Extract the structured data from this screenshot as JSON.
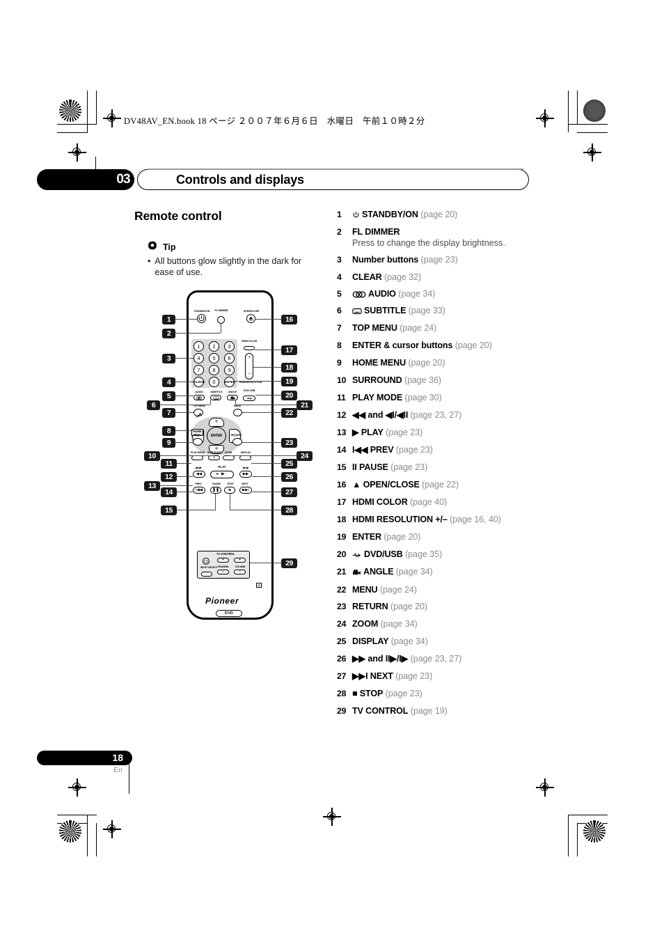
{
  "book_header": "DV48AV_EN.book  18 ページ  ２００７年６月６日　水曜日　午前１０時２分",
  "chapter": {
    "number": "03",
    "title": "Controls and displays"
  },
  "section": {
    "title": "Remote control"
  },
  "tip": {
    "icon": "gear-icon",
    "label": "Tip",
    "bullet": "•",
    "text": "All buttons glow slightly in the dark for ease of use."
  },
  "footer": {
    "page": "18",
    "language": "En"
  },
  "remote": {
    "brand": "Pioneer",
    "mode_badge": "DVD",
    "labels": {
      "standby": "STANDBY/ON",
      "fl_dimmer": "FL DIMMER",
      "open_close": "OPEN/CLOSE",
      "hdmi_color": "HDMI COLOR",
      "hdmi_resolution": "HDMI RESOLUTION",
      "dvd_usb": "DVD/ USB",
      "audio": "AUDIO",
      "subtitle": "SUBTITLE",
      "angle": "ANGLE",
      "clear": "CLEAR",
      "enter": "ENTER",
      "top_menu": "TOP MENU",
      "menu": "MENU",
      "home_menu": "HOME MENU",
      "return": "RETURN",
      "play_mode": "PLAY MODE",
      "surround": "SURROUND",
      "zoom": "ZOOM",
      "display": "DISPLAY",
      "play": "PLAY",
      "prev": "PREV",
      "pause": "PAUSE",
      "stop": "STOP",
      "next": "NEXT",
      "scan_rev": "◀I/◀II",
      "scan_fwd": "II▶/I▶",
      "tv_control": "TV  CONTROL",
      "input_select": "INPUT SELECT",
      "channel": "CHANNEL",
      "volume": "VOLUME",
      "plus": "+",
      "minus": "–"
    },
    "number_keys": [
      "1",
      "2",
      "3",
      "4",
      "5",
      "6",
      "7",
      "8",
      "9",
      "0"
    ],
    "callouts_left": [
      "1",
      "2",
      "3",
      "4",
      "5",
      "6",
      "7",
      "8",
      "9",
      "10",
      "11",
      "12",
      "13",
      "14",
      "15"
    ],
    "callouts_right": [
      "16",
      "17",
      "18",
      "19",
      "20",
      "21",
      "22",
      "23",
      "24",
      "25",
      "26",
      "27",
      "28",
      "29"
    ]
  },
  "items": [
    {
      "num": "1",
      "icon": "power-icon",
      "label": "STANDBY/ON",
      "page": "(page 20)",
      "desc": ""
    },
    {
      "num": "2",
      "icon": "",
      "label": "FL DIMMER",
      "page": "",
      "desc": "Press to change the display brightness."
    },
    {
      "num": "3",
      "icon": "",
      "label": "Number buttons",
      "page": "(page 23)",
      "desc": ""
    },
    {
      "num": "4",
      "icon": "",
      "label": "CLEAR",
      "page": "(page 32)",
      "desc": ""
    },
    {
      "num": "5",
      "icon": "audio-icon",
      "label": "AUDIO",
      "page": "(page 34)",
      "desc": ""
    },
    {
      "num": "6",
      "icon": "subtitle-icon",
      "label": "SUBTITLE",
      "page": "(page 33)",
      "desc": ""
    },
    {
      "num": "7",
      "icon": "",
      "label": "TOP MENU",
      "page": "(page 24)",
      "desc": ""
    },
    {
      "num": "8",
      "icon": "",
      "label": "ENTER & cursor buttons",
      "page": "(page 20)",
      "desc": ""
    },
    {
      "num": "9",
      "icon": "",
      "label": "HOME MENU",
      "page": "(page 20)",
      "desc": ""
    },
    {
      "num": "10",
      "icon": "",
      "label": "SURROUND",
      "page": "(page 36)",
      "desc": ""
    },
    {
      "num": "11",
      "icon": "",
      "label": "PLAY MODE",
      "page": "(page 30)",
      "desc": ""
    },
    {
      "num": "12",
      "icon": "",
      "label": "◀◀ and ◀I/◀II",
      "page": "(page 23, 27)",
      "desc": ""
    },
    {
      "num": "13",
      "icon": "",
      "label": "▶ PLAY",
      "page": "(page 23)",
      "desc": ""
    },
    {
      "num": "14",
      "icon": "",
      "label": "I◀◀ PREV",
      "page": "(page 23)",
      "desc": ""
    },
    {
      "num": "15",
      "icon": "",
      "label": "II PAUSE",
      "page": "(page 23)",
      "desc": ""
    },
    {
      "num": "16",
      "icon": "",
      "label": "▲ OPEN/CLOSE",
      "page": "(page 22)",
      "desc": ""
    },
    {
      "num": "17",
      "icon": "",
      "label": "HDMI COLOR",
      "page": "(page 40)",
      "desc": ""
    },
    {
      "num": "18",
      "icon": "",
      "label": "HDMI RESOLUTION +/–",
      "page": "(page 16, 40)",
      "desc": ""
    },
    {
      "num": "19",
      "icon": "",
      "label": "ENTER",
      "page": "(page 20)",
      "desc": ""
    },
    {
      "num": "20",
      "icon": "usb-icon",
      "label": "DVD/USB",
      "page": "(page 35)",
      "desc": ""
    },
    {
      "num": "21",
      "icon": "angle-icon",
      "label": "ANGLE",
      "page": "(page 34)",
      "desc": ""
    },
    {
      "num": "22",
      "icon": "",
      "label": "MENU",
      "page": "(page 24)",
      "desc": ""
    },
    {
      "num": "23",
      "icon": "",
      "label": "RETURN",
      "page": "(page 20)",
      "desc": ""
    },
    {
      "num": "24",
      "icon": "",
      "label": "ZOOM",
      "page": "(page 34)",
      "desc": ""
    },
    {
      "num": "25",
      "icon": "",
      "label": "DISPLAY",
      "page": "(page 34)",
      "desc": ""
    },
    {
      "num": "26",
      "icon": "",
      "label": "▶▶ and II▶/I▶",
      "page": "(page 23, 27)",
      "desc": ""
    },
    {
      "num": "27",
      "icon": "",
      "label": "▶▶I NEXT",
      "page": "(page 23)",
      "desc": ""
    },
    {
      "num": "28",
      "icon": "",
      "label": "■ STOP",
      "page": "(page 23)",
      "desc": ""
    },
    {
      "num": "29",
      "icon": "",
      "label": "TV CONTROL",
      "page": "(page 19)",
      "desc": ""
    }
  ]
}
